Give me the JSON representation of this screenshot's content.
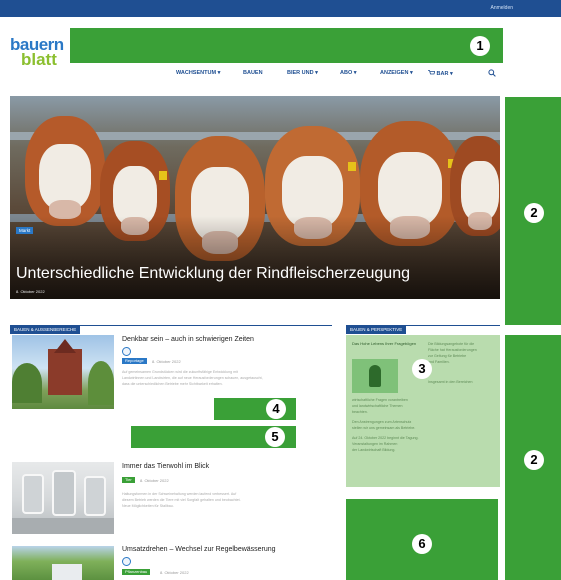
{
  "topbar": {
    "login_label": "Anmelden"
  },
  "logo": {
    "line1": "bauern",
    "line2": "blatt"
  },
  "ad_badges": [
    "1",
    "2",
    "2",
    "3",
    "4",
    "5",
    "6"
  ],
  "nav": {
    "items": [
      "WACHSENTUM",
      "BAUEN",
      "BIER UND",
      "ABO",
      "ANZEIGEN",
      "BAR"
    ],
    "chevron": "▾"
  },
  "hero": {
    "category": "Markt",
    "title": "Unterschiedliche Entwicklung der Rindfleischerzeugung",
    "date": "8. Oktober 2022"
  },
  "sections": {
    "left_header": "BAUEN & AUSSENBEREICHE",
    "right_header": "BAUEN & PERSPEKTIVE"
  },
  "articles": [
    {
      "title": "Denkbar sein – auch in schwierigen Zeiten",
      "tag": "Reportage",
      "date": "8. Oktober 2022",
      "tag_color": "#2a78c6",
      "text": [
        "Auf gemeinsamen Grundstücken wird die zukunftsfähige Entwicklung mit",
        "Landwirtinnen und Landwirten, die auf neue Herausforderungen schauen, ausgetauscht,",
        "dass die unterschiedlichen Betriebe mehr Sichtbarkeit erhalten."
      ]
    },
    {
      "title": "Immer das Tierwohl im Blick",
      "tag": "Tier",
      "date": "8. Oktober 2022",
      "tag_color": "#3aa037",
      "text": [
        "Haltungsformen in der Schweinehaltung werden laufend verbessert. Auf",
        "diesem Betrieb werden die Tiere mit viel Sorgfalt gehalten und beobachtet.",
        "Neue Möglichkeiten für Stallbau."
      ]
    },
    {
      "title": "Umsatzdrehen – Wechsel zur Regelbewässerung",
      "tag": "Pflanzenbau",
      "date": "8. Oktober 2022",
      "tag_color": "#3aa037"
    }
  ],
  "sidebar_box": {
    "title": "Das Hohe Lebens Ihrer Fragebögen",
    "lines": [
      "Die Bildungsangebote für die",
      "Fläche hat Herausforderungen",
      "zur Geltung für Betriebe",
      "und Familien.",
      "",
      "Insgesamt in den Bereichen",
      "wirtschaftliche Fragen vorantreiben",
      "und landwirtschaftliche Themen",
      "beachten.",
      "Den Anstrengungen zum Artenschutz",
      "stellen wir uns gemeinsam als Betriebe.",
      "Auf 24. Oktober 2022 beginnt die Tagung.",
      "Veranstaltungen im Rahmen",
      "der Landwirtschaft Bildung."
    ]
  },
  "colors": {
    "brand_blue": "#1f4f92",
    "ad_green": "#3aa037",
    "logo_green": "#8bbf2f"
  }
}
